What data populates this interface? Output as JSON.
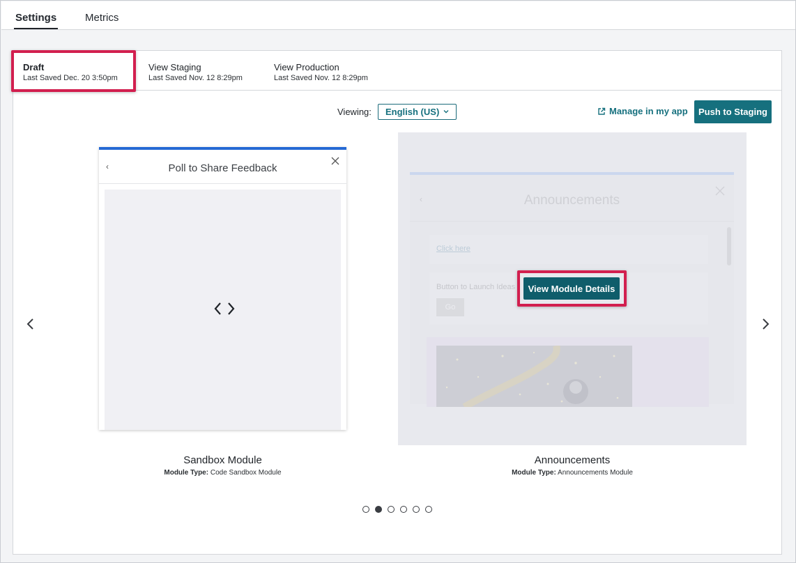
{
  "tabs": [
    {
      "label": "Settings",
      "active": true
    },
    {
      "label": "Metrics",
      "active": false
    }
  ],
  "versions": [
    {
      "title": "Draft",
      "saved": "Last Saved Dec. 20 3:50pm",
      "active": true
    },
    {
      "title": "View Staging",
      "saved": "Last Saved Nov. 12 8:29pm",
      "active": false
    },
    {
      "title": "View Production",
      "saved": "Last Saved Nov. 12 8:29pm",
      "active": false
    }
  ],
  "viewing": {
    "label": "Viewing:",
    "selected_language": "English (US)"
  },
  "actions": {
    "manage_label": "Manage in my app",
    "push_label": "Push to Staging"
  },
  "modules": [
    {
      "card_title": "Poll to Share Feedback",
      "name": "Sandbox Module",
      "type_label": "Module Type:",
      "type_value": "Code Sandbox Module"
    },
    {
      "card_title": "Announcements",
      "name": "Announcements",
      "type_label": "Module Type:",
      "type_value": "Announcements Module",
      "link_text": "Click here",
      "launch_label": "Button to Launch Ideas",
      "go_label": "Go",
      "details_button": "View Module Details"
    }
  ],
  "carousel": {
    "page_count": 6,
    "active_index": 1
  },
  "colors": {
    "accent": "#16707e",
    "highlight": "#d21f4f",
    "card_top": "#2569d4"
  }
}
